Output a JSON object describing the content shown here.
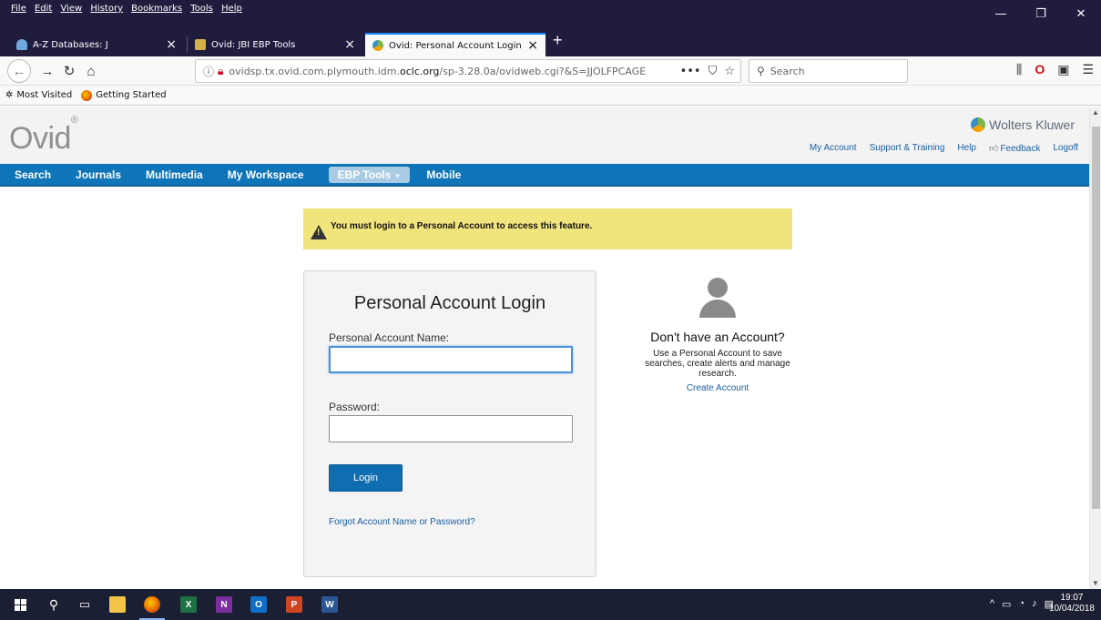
{
  "browser": {
    "menu": [
      "File",
      "Edit",
      "View",
      "History",
      "Bookmarks",
      "Tools",
      "Help"
    ],
    "window_controls": {
      "minimize": "—",
      "restore": "❐",
      "close": "✕"
    },
    "tabs": [
      {
        "title": "A-Z Databases: J",
        "close": "×"
      },
      {
        "title": "Ovid: JBI EBP Tools",
        "close": "×"
      },
      {
        "title": "Ovid: Personal Account Login",
        "close": "×"
      }
    ],
    "new_tab": "+",
    "url_prefix": "ovidsp.tx.ovid.com.plymouth.idm.",
    "url_domain": "oclc.org",
    "url_suffix": "/sp-3.28.0a/ovidweb.cgi?&S=JJOLFPCAGE",
    "url_actions": "•••",
    "search_placeholder": "Search",
    "bookmarks": [
      "Most Visited",
      "Getting Started"
    ]
  },
  "ovid": {
    "logo": "Ovid",
    "logo_mark": "®",
    "brand": "Wolters Kluwer",
    "toplinks": [
      "My Account",
      "Support & Training",
      "Help",
      "Feedback",
      "Logoff"
    ],
    "nav": [
      "Search",
      "Journals",
      "Multimedia",
      "My Workspace",
      "EBP Tools",
      "Mobile"
    ],
    "alert": "You must login to a Personal Account to access this feature.",
    "login": {
      "title": "Personal Account Login",
      "name_label": "Personal Account Name:",
      "name_value": "",
      "password_label": "Password:",
      "password_value": "",
      "button": "Login",
      "forgot": "Forgot Account Name or Password?"
    },
    "signup": {
      "title": "Don't have an Account?",
      "description": "Use a Personal Account to save searches, create alerts and manage research.",
      "link": "Create Account"
    }
  },
  "taskbar": {
    "time": "19:07",
    "date": "10/04/2018"
  },
  "colors": {
    "nav_blue": "#0f74b8",
    "alert_yellow": "#f0e47d",
    "link_blue": "#1a5fa0",
    "chrome_dark": "#1f1c3e"
  }
}
